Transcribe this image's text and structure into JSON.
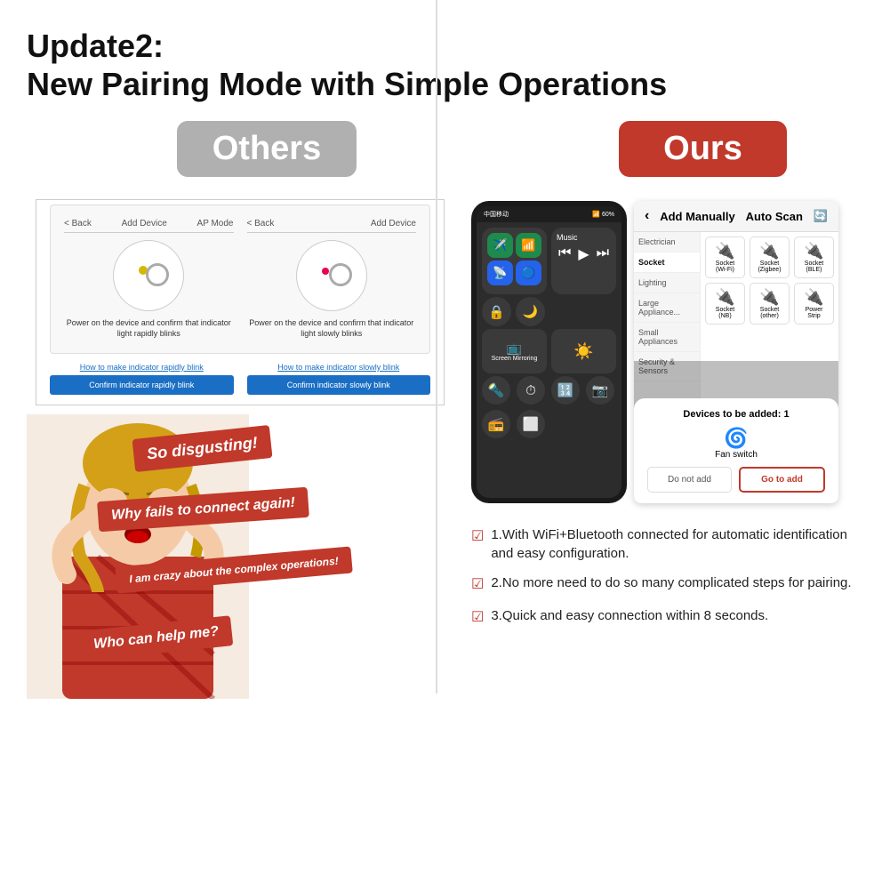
{
  "header": {
    "line1": "Update2:",
    "line2": "New Pairing Mode with Simple Operations"
  },
  "left": {
    "badge": "Others",
    "device1": {
      "nav_back": "< Back",
      "nav_title": "Add Device",
      "nav_mode": "AP Mode",
      "caption": "Power on the device and confirm that indicator light rapidly blinks"
    },
    "device2": {
      "nav_back": "< Back",
      "nav_title": "Add Device",
      "caption": "Power on the device and confirm that indicator light slowly blinks"
    },
    "link1": "How to make indicator rapidly blink",
    "link2": "How to make indicator slowly blink",
    "btn1": "Confirm indicator rapidly blink",
    "btn2": "Confirm indicator slowly blink",
    "bubbles": [
      "So disgusting!",
      "Why fails to connect again!",
      "I am crazy about the complex operations!",
      "Who can help me?"
    ]
  },
  "right": {
    "badge": "Ours",
    "phone_left": {
      "status": "中国移动",
      "signal": "60%",
      "wifi_icon": "📶",
      "music_title": "Music",
      "controls": [
        "⏮",
        "▶",
        "⏭"
      ]
    },
    "app": {
      "title": "Add Manually",
      "tab2": "Auto Scan",
      "categories": [
        "Electrician",
        "Socket",
        "Lighting",
        "Large Appliance",
        "Small Appliance",
        "Security & Sensors"
      ],
      "socket_items": [
        "Socket (Wi-Fi)",
        "Socket (Zigbee)",
        "Socket (BLE)",
        "Socket (NB)",
        "Socket (other)",
        "Power Strip"
      ],
      "dialog_title": "Devices to be added: 1",
      "device_name": "Fan switch",
      "btn_cancel": "Do not add",
      "btn_confirm": "Go to add"
    },
    "features": [
      "1.With WiFi+Bluetooth connected for automatic identification and easy configuration.",
      "2.No more need to do so many complicated steps for pairing.",
      "3.Quick and easy connection within 8 seconds."
    ]
  }
}
